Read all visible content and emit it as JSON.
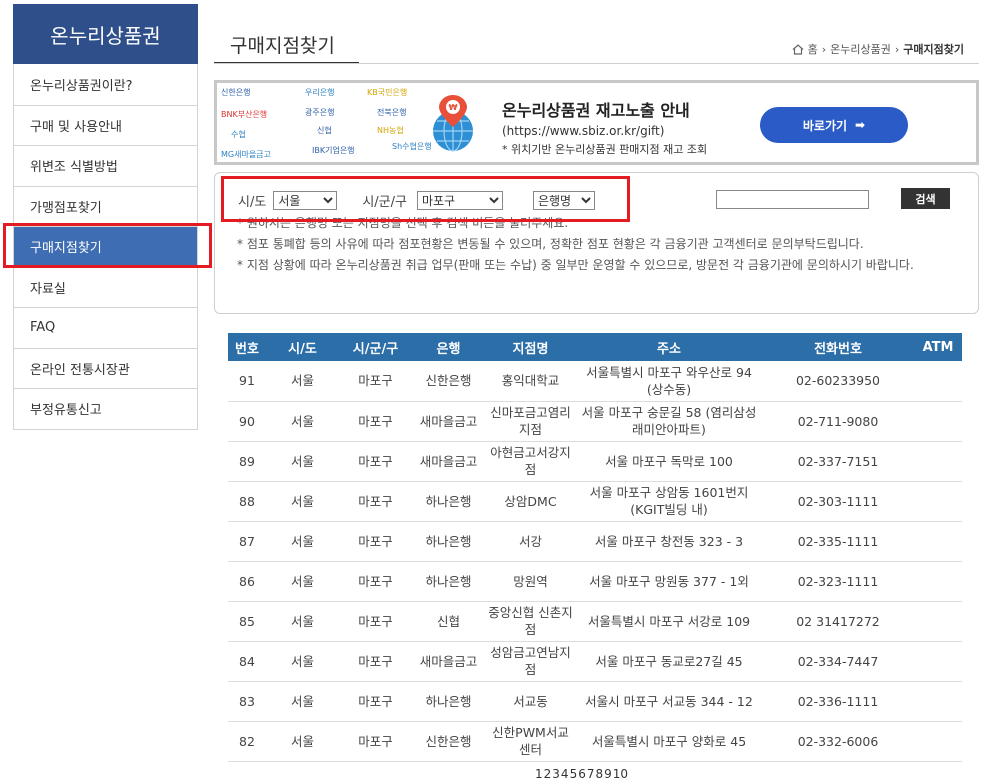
{
  "sidebar": {
    "title": "온누리상품권",
    "items": [
      {
        "label": "온누리상품권이란?"
      },
      {
        "label": "구매 및 사용안내"
      },
      {
        "label": "위변조 식별방법"
      },
      {
        "label": "가맹점포찾기"
      },
      {
        "label": "구매지점찾기",
        "active": true
      },
      {
        "label": "자료실"
      },
      {
        "label": "FAQ"
      },
      {
        "label": "온라인 전통시장관"
      },
      {
        "label": "부정유통신고"
      }
    ]
  },
  "header": {
    "title": "구매지점찾기",
    "breadcrumb": [
      "홈",
      "온누리상품권",
      "구매지점찾기"
    ]
  },
  "banner": {
    "banks": [
      "신한은행",
      "우리은행",
      "KB국민은행",
      "BNK부산은행",
      "광주은행",
      "전북은행",
      "수협",
      "신협",
      "NH농협",
      "MG새마을금고",
      "IBK기업은행",
      "Sh수협은행"
    ],
    "title": "온누리상품권 재고노출 안내",
    "url": "(https://www.sbiz.or.kr/gift)",
    "note": "* 위치기반 온누리상품권 판매지점 재고 조회",
    "button_label": "바로가기"
  },
  "search": {
    "sido_label": "시/도",
    "sido_value": "서울",
    "gu_label": "시/군/구",
    "gu_value": "마포구",
    "bank_value": "은행명",
    "input_value": "",
    "button_label": "검색",
    "notes": [
      "* 원하시는 은행명 또는 지점명을 선택 후 검색 버튼을 눌러주세요.",
      "* 점포 통폐합 등의 사유에 따라 점포현황은 변동될 수 있으며, 정확한 점포 현황은 각 금융기관 고객센터로 문의부탁드립니다.",
      "* 지점 상황에 따라 온누리상품권 취급 업무(판매 또는 수납) 중 일부만 운영할 수 있으므로, 방문전 각 금융기관에 문의하시기 바랍니다."
    ]
  },
  "table": {
    "headers": [
      "번호",
      "시/도",
      "시/군/구",
      "은행",
      "지점명",
      "주소",
      "전화번호",
      "ATM"
    ],
    "rows": [
      [
        "91",
        "서울",
        "마포구",
        "신한은행",
        "홍익대학교",
        "서울특별시 마포구 와우산로 94 (상수동)",
        "02-60233950",
        ""
      ],
      [
        "90",
        "서울",
        "마포구",
        "새마을금고",
        "신마포금고염리지점",
        "서울 마포구 숭문길 58 (염리삼성래미안아파트)",
        "02-711-9080",
        ""
      ],
      [
        "89",
        "서울",
        "마포구",
        "새마을금고",
        "아현금고서강지점",
        "서울 마포구 독막로 100",
        "02-337-7151",
        ""
      ],
      [
        "88",
        "서울",
        "마포구",
        "하나은행",
        "상암DMC",
        "서울 마포구 상암동 1601번지 (KGIT빌딩 내)",
        "02-303-1111",
        ""
      ],
      [
        "87",
        "서울",
        "마포구",
        "하나은행",
        "서강",
        "서울 마포구 창전동 323 - 3",
        "02-335-1111",
        ""
      ],
      [
        "86",
        "서울",
        "마포구",
        "하나은행",
        "망원역",
        "서울 마포구 망원동 377 - 1외",
        "02-323-1111",
        ""
      ],
      [
        "85",
        "서울",
        "마포구",
        "신협",
        "중앙신협 신촌지점",
        "서울특별시 마포구 서강로 109",
        "02 31417272",
        ""
      ],
      [
        "84",
        "서울",
        "마포구",
        "새마을금고",
        "성암금고연남지점",
        "서울 마포구 동교로27길 45",
        "02-334-7447",
        ""
      ],
      [
        "83",
        "서울",
        "마포구",
        "하나은행",
        "서교동",
        "서울시 마포구 서교동 344 - 12",
        "02-336-1111",
        ""
      ],
      [
        "82",
        "서울",
        "마포구",
        "신한은행",
        "신한PWM서교센터",
        "서울특별시 마포구 양화로 45",
        "02-332-6006",
        ""
      ]
    ]
  },
  "pagination": [
    "1",
    "2",
    "3",
    "4",
    "5",
    "6",
    "7",
    "8",
    "9",
    "10"
  ],
  "colors": {
    "sidebar_head": "#2e4f8a",
    "sidebar_active": "#3e6db4",
    "table_header": "#2b6ea8",
    "button_blue": "#2a5bc6",
    "highlight_red": "#e31b23"
  }
}
